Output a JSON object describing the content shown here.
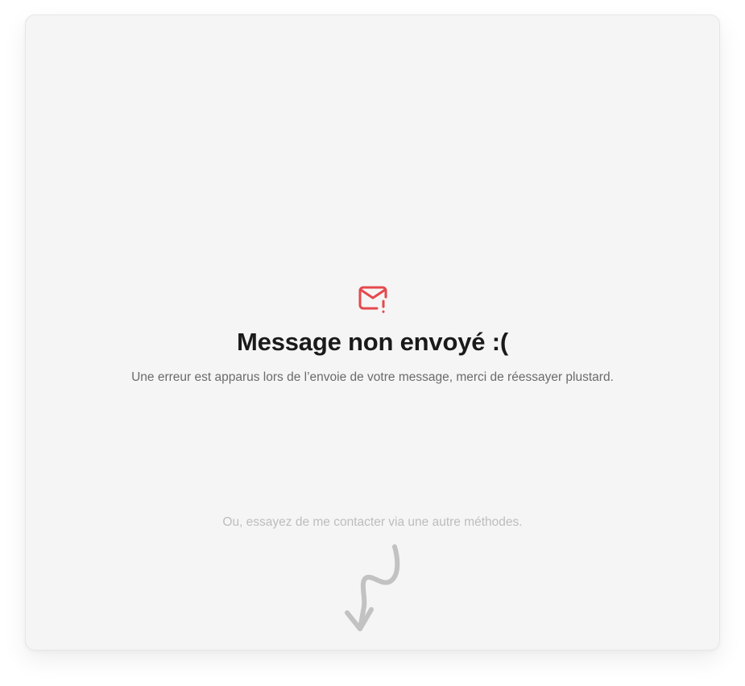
{
  "status": {
    "icon": "mail-error-icon",
    "icon_color": "#e5484d",
    "title": "Message non envoyé :(",
    "description": "Une erreur est apparus lors de l’envoie de votre message, merci de réessayer plustard."
  },
  "alternative": {
    "text": "Ou, essayez de me contacter via une autre méthodes.",
    "arrow_icon": "hand-drawn-arrow-down-icon"
  }
}
